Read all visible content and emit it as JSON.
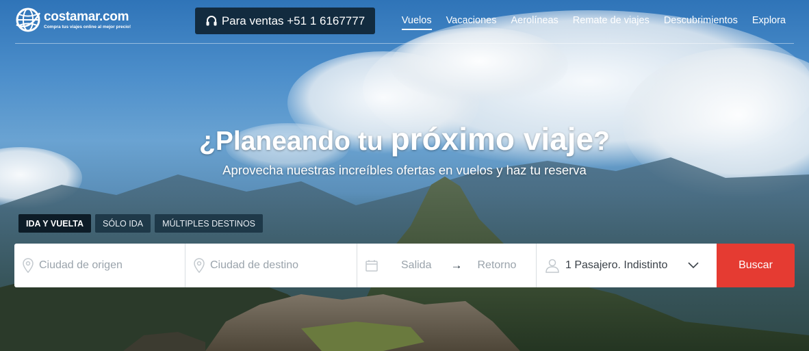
{
  "brand": {
    "name": "costamar.com",
    "tagline": "Compra tus viajes online al mejor precio!"
  },
  "phone": {
    "label": "Para ventas +51 1 6167777",
    "icon": "headset-icon"
  },
  "nav": {
    "items": [
      {
        "label": "Vuelos",
        "active": true
      },
      {
        "label": "Vacaciones",
        "active": false
      },
      {
        "label": "Aerolíneas",
        "active": false
      },
      {
        "label": "Remate de viajes",
        "active": false
      },
      {
        "label": "Descubrimientos",
        "active": false
      },
      {
        "label": "Explora",
        "active": false
      }
    ]
  },
  "hero": {
    "title_prefix": "¿Planeando tu ",
    "title_emphasis": "próximo viaje",
    "title_suffix": "?",
    "subtitle": "Aprovecha nuestras increíbles ofertas en vuelos y haz tu reserva"
  },
  "trip_tabs": [
    {
      "label": "IDA Y VUELTA",
      "active": true
    },
    {
      "label": "SÓLO IDA",
      "active": false
    },
    {
      "label": "MÚLTIPLES DESTINOS",
      "active": false
    }
  ],
  "search": {
    "origin_placeholder": "Ciudad de origen",
    "destination_placeholder": "Ciudad de destino",
    "departure_placeholder": "Salida",
    "return_placeholder": "Retorno",
    "date_arrow": "→",
    "passengers": "1 Pasajero. Indistinto",
    "button": "Buscar"
  },
  "colors": {
    "search_button": "#e53b32",
    "phone_button": "#122b3f",
    "active_tab": "#0d1c27"
  }
}
